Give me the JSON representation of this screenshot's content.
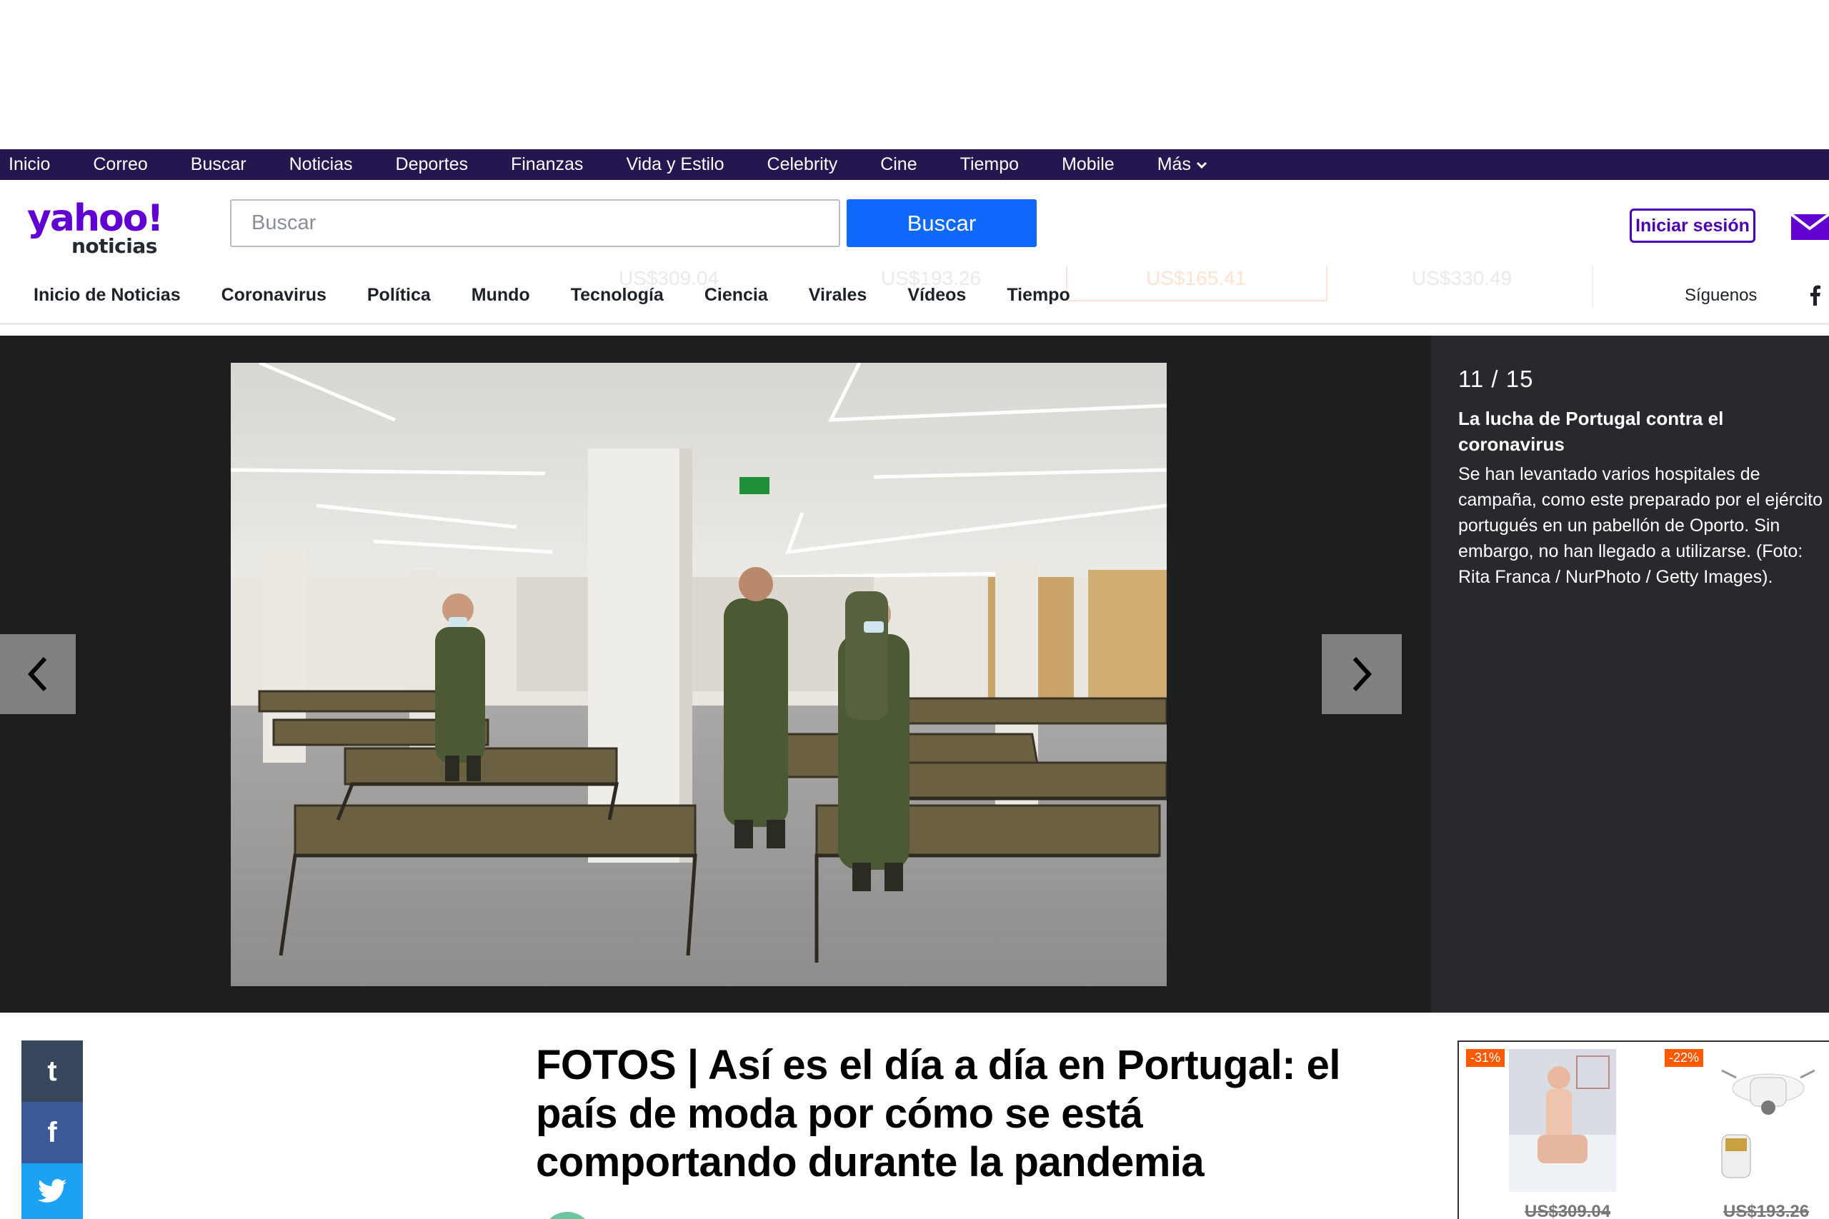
{
  "topbar": {
    "items": [
      "Inicio",
      "Correo",
      "Buscar",
      "Noticias",
      "Deportes",
      "Finanzas",
      "Vida y Estilo",
      "Celebrity",
      "Cine",
      "Tiempo",
      "Mobile"
    ],
    "more_label": "Más"
  },
  "header": {
    "logo_main": "yahoo!",
    "logo_sub": "noticias",
    "search_placeholder": "Buscar",
    "search_button": "Buscar",
    "signin_label": "Iniciar sesión"
  },
  "sections": {
    "items": [
      "Inicio de Noticias",
      "Coronavirus",
      "Política",
      "Mundo",
      "Tecnología",
      "Ciencia",
      "Virales",
      "Vídeos",
      "Tiempo"
    ],
    "follow_label": "Síguenos",
    "ghost_prices": [
      "US$309.04",
      "US$193.26",
      "US$165.41",
      "US$330.49"
    ]
  },
  "gallery": {
    "counter": "11 / 15",
    "title": "La lucha de Portugal contra el coronavirus",
    "description": "Se han levantado varios hospitales de campaña, como este preparado por el ejército portugués en un pabellón de Oporto. Sin embargo, no han llegado a utilizarse. (Foto: Rita Franca / NurPhoto / Getty Images)."
  },
  "share": {
    "tumblr": "t",
    "facebook": "f"
  },
  "article": {
    "headline": "FOTOS | Así es el día a día en Portugal: el país de moda por cómo se está comportando durante la pandemia"
  },
  "ads": [
    {
      "discount": "-31%",
      "price": "US$309.04"
    },
    {
      "discount": "-22%",
      "price": "US$193.26"
    }
  ],
  "colors": {
    "brand_purple": "#6001d2",
    "topbar": "#26164f",
    "search_blue": "#0f69ff"
  }
}
